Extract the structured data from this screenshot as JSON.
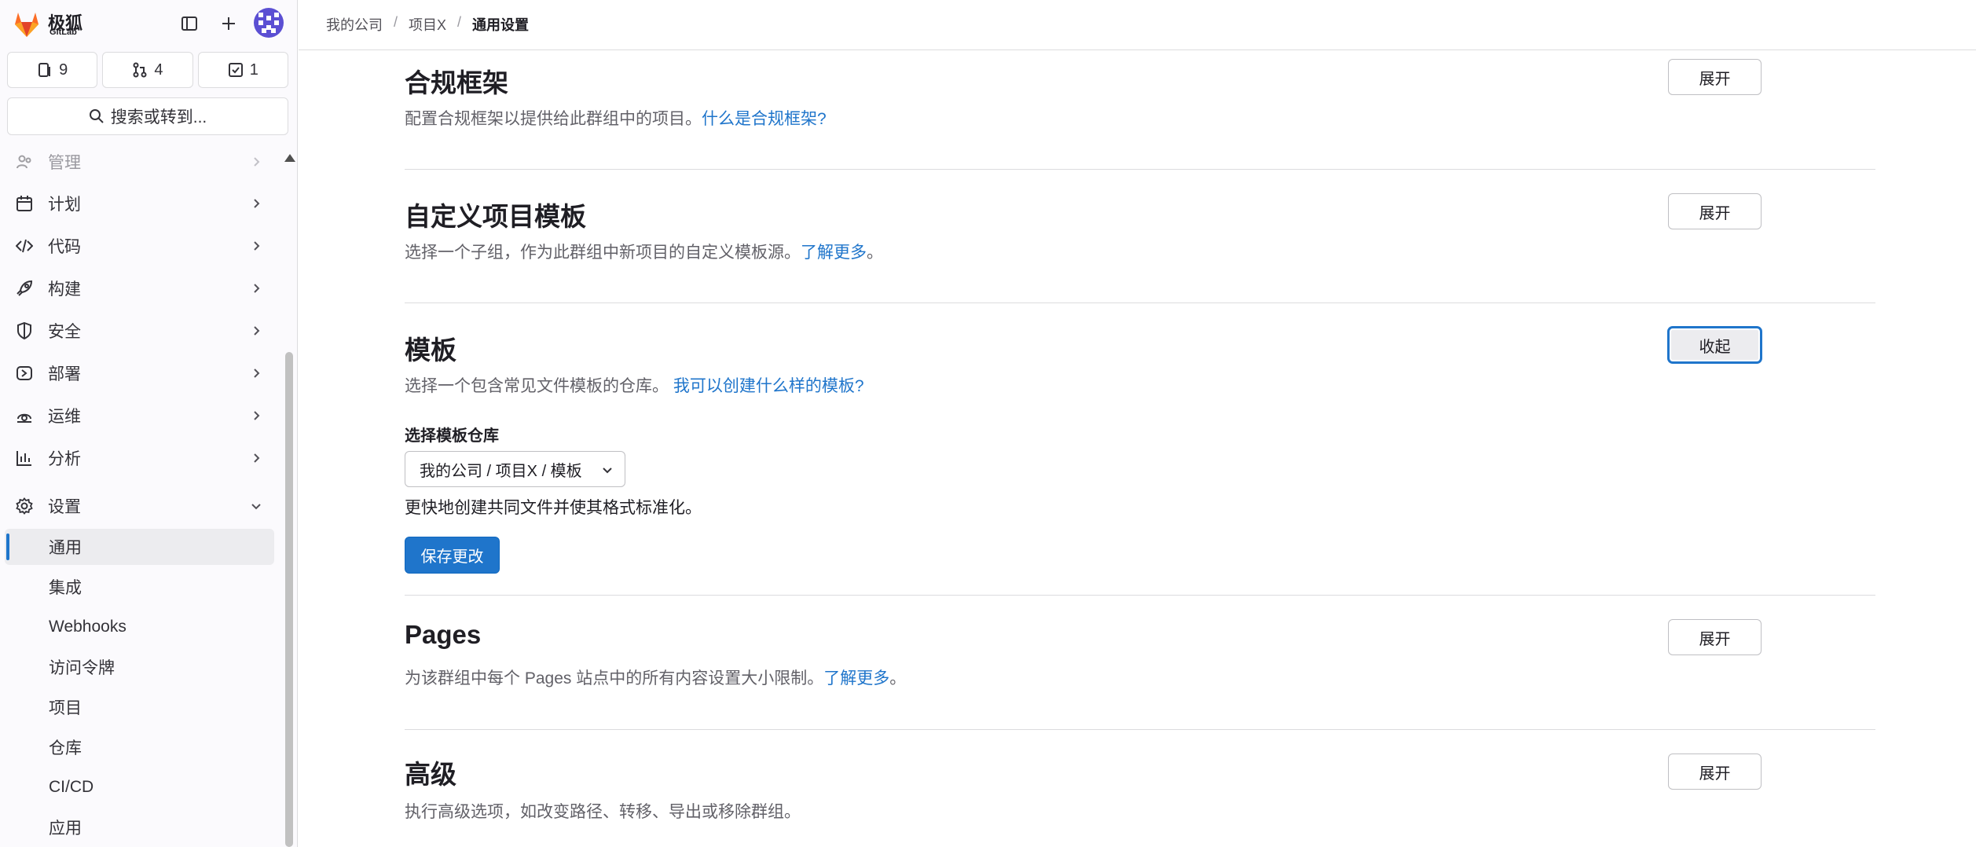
{
  "brand": {
    "name": "极狐",
    "sub": "GitLab"
  },
  "counters": [
    {
      "icon": "issues-icon",
      "count": "9"
    },
    {
      "icon": "merge-request-icon",
      "count": "4"
    },
    {
      "icon": "todo-icon",
      "count": "1"
    }
  ],
  "search": {
    "label": "搜索或转到..."
  },
  "nav": {
    "items": [
      {
        "label": "管理",
        "icon": "users-icon"
      },
      {
        "label": "计划",
        "icon": "calendar-icon"
      },
      {
        "label": "代码",
        "icon": "code-icon"
      },
      {
        "label": "构建",
        "icon": "rocket-icon"
      },
      {
        "label": "安全",
        "icon": "shield-icon"
      },
      {
        "label": "部署",
        "icon": "deploy-icon"
      },
      {
        "label": "运维",
        "icon": "monitor-icon"
      },
      {
        "label": "分析",
        "icon": "chart-icon"
      },
      {
        "label": "设置",
        "icon": "settings-icon"
      }
    ],
    "settings_sub": [
      "通用",
      "集成",
      "Webhooks",
      "访问令牌",
      "项目",
      "仓库",
      "CI/CD",
      "应用"
    ]
  },
  "breadcrumb": [
    "我的公司",
    "项目X",
    "通用设置"
  ],
  "sections": {
    "compliance": {
      "title": "合规框架",
      "desc": "配置合规框架以提供给此群组中的项目。",
      "link": "什么是合规框架?",
      "button": "展开"
    },
    "custom_templates": {
      "title": "自定义项目模板",
      "desc": "选择一个子组，作为此群组中新项目的自定义模板源。",
      "link": "了解更多",
      "suffix": "。",
      "button": "展开"
    },
    "templates": {
      "title": "模板",
      "desc": "选择一个包含常见文件模板的仓库。",
      "link": "我可以创建什么样的模板?",
      "button": "收起",
      "field_label": "选择模板仓库",
      "selected_repo": "我的公司 / 项目X / 模板",
      "help": "更快地创建共同文件并使其格式标准化。",
      "save": "保存更改"
    },
    "pages": {
      "title": "Pages",
      "desc": "为该群组中每个 Pages 站点中的所有内容设置大小限制。",
      "link": "了解更多",
      "suffix": "。",
      "button": "展开"
    },
    "advanced": {
      "title": "高级",
      "desc": "执行高级选项，如改变路径、转移、导出或移除群组。",
      "button": "展开"
    }
  },
  "colors": {
    "accent": "#1f75cb",
    "logo": "#fc6d26"
  }
}
